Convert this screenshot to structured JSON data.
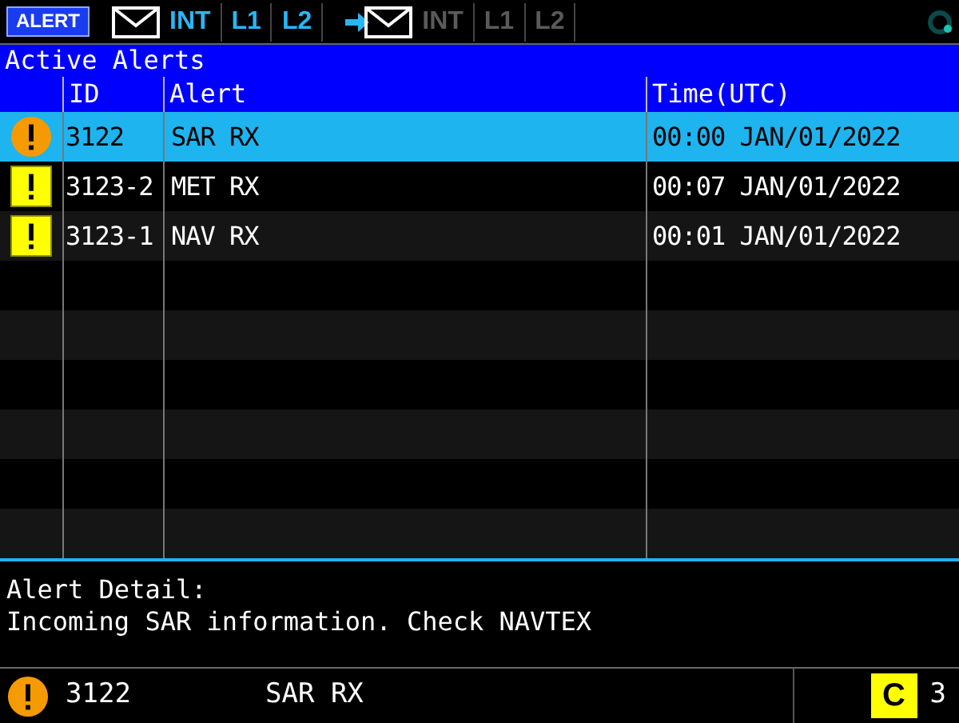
{
  "top_bar": {
    "alert_button": "ALERT",
    "groups": [
      {
        "kind": "receive",
        "enabled": true,
        "items": [
          "INT",
          "L1",
          "L2"
        ]
      },
      {
        "kind": "send",
        "enabled": false,
        "items": [
          "INT",
          "L1",
          "L2"
        ]
      }
    ]
  },
  "title": "Active Alerts",
  "table": {
    "columns": [
      "ID",
      "Alert",
      "Time(UTC)"
    ],
    "rows": [
      {
        "kind": "warning",
        "id": "3122",
        "alert": "SAR RX",
        "time": "00:00 JAN/01/2022",
        "selected": true
      },
      {
        "kind": "caution",
        "id": "3123-2",
        "alert": "MET RX",
        "time": "00:07 JAN/01/2022",
        "selected": false
      },
      {
        "kind": "caution",
        "id": "3123-1",
        "alert": "NAV RX",
        "time": "00:01 JAN/01/2022",
        "selected": false
      }
    ]
  },
  "detail": {
    "label": "Alert Detail:",
    "text": "Incoming SAR information. Check NAVTEX"
  },
  "status_bar": {
    "kind": "warning",
    "id": "3122",
    "alert": "SAR RX",
    "badge": "C",
    "count": "3"
  }
}
